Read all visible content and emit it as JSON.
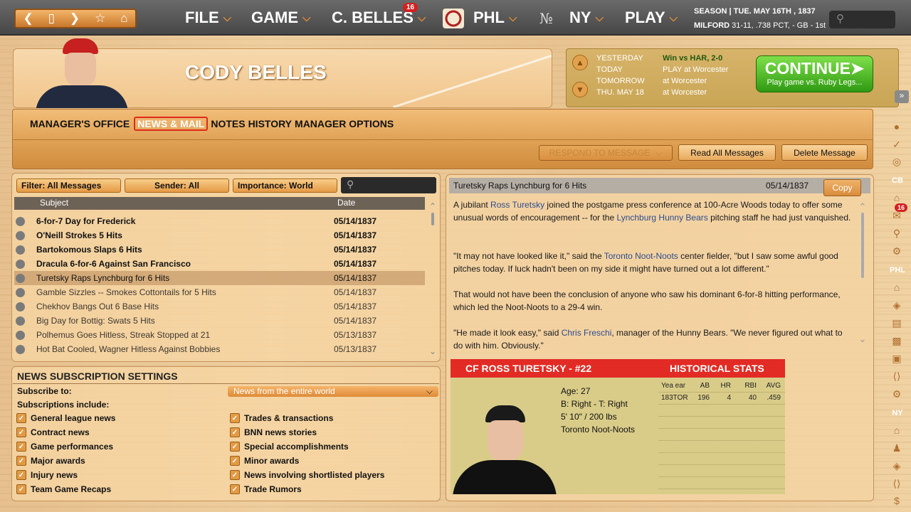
{
  "topbar": {
    "nav_icons": [
      "left-arrow",
      "page",
      "right-arrow",
      "star",
      "home"
    ],
    "menus": [
      "FILE",
      "GAME",
      "C. BELLES",
      "PHL",
      "NY",
      "PLAY"
    ],
    "belles_badge": "16",
    "season_label": "SEASON",
    "season_sep": "|",
    "date": "TUE. MAY 16TH , 1837",
    "team": "MILFORD",
    "record": "31-11, .738 PCT, - GB - 1st"
  },
  "player": {
    "name": "CODY BELLES"
  },
  "schedule": [
    {
      "label": "YESTERDAY",
      "value": "Win vs HAR, 2-0"
    },
    {
      "label": "TODAY",
      "value": "PLAY at Worcester"
    },
    {
      "label": "TOMORROW",
      "value": "at Worcester"
    },
    {
      "label": "THU. MAY 18",
      "value": "at Worcester"
    }
  ],
  "continue": {
    "label": "CONTINUE",
    "sub": "Play game vs. Ruby Legs..."
  },
  "tabs": [
    "MANAGER'S OFFICE",
    "NEWS & MAIL",
    "NOTES",
    "HISTORY",
    "MANAGER OPTIONS"
  ],
  "actions": {
    "respond": "RESPOND TO MESSAGE",
    "read_all": "Read All Messages",
    "delete": "Delete Message"
  },
  "filters": {
    "filter": "Filter: All Messages",
    "sender": "Sender: All",
    "importance": "Importance: World"
  },
  "list": {
    "col_subject": "Subject",
    "col_date": "Date",
    "rows": [
      {
        "subject": "6-for-7 Day for Frederick",
        "date": "05/14/1837",
        "style": "bold"
      },
      {
        "subject": "O'Neill Strokes 5 Hits",
        "date": "05/14/1837",
        "style": "bold"
      },
      {
        "subject": "Bartokomous Slaps 6 Hits",
        "date": "05/14/1837",
        "style": "bold"
      },
      {
        "subject": "Dracula 6-for-6 Against San Francisco",
        "date": "05/14/1837",
        "style": "bold"
      },
      {
        "subject": "Turetsky Raps Lynchburg for 6 Hits",
        "date": "05/14/1837",
        "style": "selected"
      },
      {
        "subject": "Gamble Sizzles -- Smokes Cottontails for 5 Hits",
        "date": "05/14/1837",
        "style": "normal"
      },
      {
        "subject": "Chekhov Bangs Out 6 Base Hits",
        "date": "05/14/1837",
        "style": "normal"
      },
      {
        "subject": "Big Day for Bottig: Swats 5 Hits",
        "date": "05/14/1837",
        "style": "normal"
      },
      {
        "subject": "Polhemus Goes Hitless, Streak Stopped at 21",
        "date": "05/13/1837",
        "style": "normal"
      },
      {
        "subject": "Hot Bat Cooled, Wagner Hitless Against Bobbies",
        "date": "05/13/1837",
        "style": "normal"
      }
    ]
  },
  "subscription": {
    "title": "NEWS SUBSCRIPTION SETTINGS",
    "subscribe_to": "Subscribe to:",
    "scope": "News from the entire world",
    "include": "Subscriptions include:",
    "left": [
      "General league news",
      "Contract news",
      "Game performances",
      "Major awards",
      "Injury news",
      "Team Game Recaps"
    ],
    "right": [
      "Trades & transactions",
      "BNN news stories",
      "Special accomplishments",
      "Minor awards",
      "News involving shortlisted players",
      "Trade Rumors"
    ]
  },
  "message": {
    "title": "Turetsky Raps Lynchburg for 6 Hits",
    "date": "05/14/1837",
    "copy": "Copy",
    "p1a": "A jubilant ",
    "p1l1": "Ross Turetsky",
    "p1b": " joined the postgame press conference at 100-Acre Woods today to offer some unusual words of encouragement -- for the ",
    "p1l2": "Lynchburg Hunny Bears",
    "p1c": " pitching staff he had just vanquished.",
    "p2a": "\"It may not have looked like it,\" said the ",
    "p2l": "Toronto Noot-Noots",
    "p2b": " center fielder, \"but I saw some awful good pitches today. If luck hadn't been on my side it might have turned out a lot different.\"",
    "p3": "That would not have been the conclusion of anyone who saw his dominant 6-for-8 hitting performance, which led the Noot-Noots to a 29-4 win.",
    "p4a": "\"He made it look easy,\" said ",
    "p4l": "Chris Freschi",
    "p4b": ", manager of the Hunny Bears. \"We never figured out what to do with him. Obviously.\""
  },
  "card": {
    "title": "CF ROSS TURETSKY - #22",
    "stats_title": "HISTORICAL STATS",
    "age": "Age: 27",
    "bt": "B: Right - T: Right",
    "size": "5' 10\" / 200 lbs",
    "team": "Toronto Noot-Noots",
    "cols": [
      "Yea ear",
      "AB",
      "HR",
      "RBI",
      "AVG"
    ],
    "row": [
      "183TOR",
      "196",
      "4",
      "40",
      ".459"
    ]
  },
  "sidebar": {
    "labels": [
      "CB",
      "PHL",
      "NY"
    ],
    "mail_badge": "16"
  }
}
